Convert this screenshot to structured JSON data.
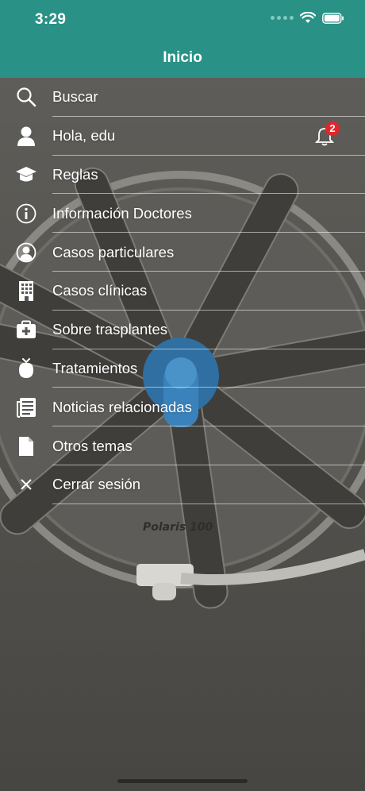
{
  "status_bar": {
    "time": "3:29"
  },
  "header": {
    "title": "Inicio"
  },
  "menu": {
    "items": [
      {
        "label": "Buscar",
        "icon": "search-icon"
      },
      {
        "label": "Hola, edu",
        "icon": "user-icon",
        "notification_count": "2"
      },
      {
        "label": "Reglas",
        "icon": "graduation-cap-icon"
      },
      {
        "label": "Información Doctores",
        "icon": "info-icon"
      },
      {
        "label": "Casos particulares",
        "icon": "user-circle-icon"
      },
      {
        "label": "Casos clínicas",
        "icon": "building-icon"
      },
      {
        "label": "Sobre trasplantes",
        "icon": "medkit-icon"
      },
      {
        "label": "Tratamientos",
        "icon": "fruit-icon"
      },
      {
        "label": "Noticias relacionadas",
        "icon": "newspaper-icon"
      },
      {
        "label": "Otros temas",
        "icon": "document-icon"
      },
      {
        "label": "Cerrar sesión",
        "icon": "close-icon"
      }
    ]
  },
  "background": {
    "lamp_brand": "Polaris 100"
  },
  "colors": {
    "header": "#2a9186",
    "badge": "#e5242a",
    "text": "#ffffff"
  }
}
